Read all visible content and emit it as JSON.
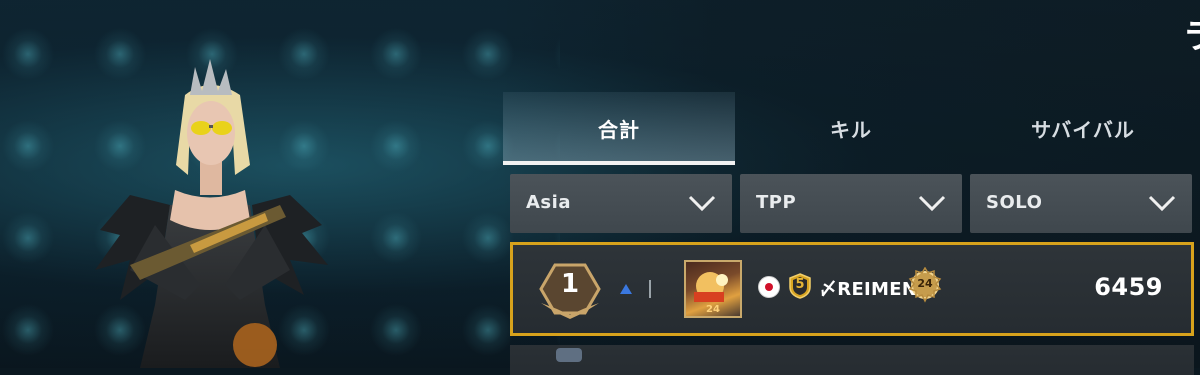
{
  "tabs": [
    {
      "label": "合計",
      "active": true
    },
    {
      "label": "キル",
      "active": false
    },
    {
      "label": "サバイバル",
      "active": false
    }
  ],
  "filters": {
    "region": "Asia",
    "perspective": "TPP",
    "mode": "SOLO"
  },
  "entry": {
    "rank": "1",
    "trend": "up",
    "avatar_level": "24",
    "flag": "japan-flag",
    "tier": "5",
    "player_name": "〆REIMEN",
    "level": "24",
    "score": "6459"
  },
  "colors": {
    "highlight_border": "#d7a21c",
    "filter_bg": "#454d53",
    "trend_up": "#3a78e0"
  },
  "corner_text": "ラ"
}
